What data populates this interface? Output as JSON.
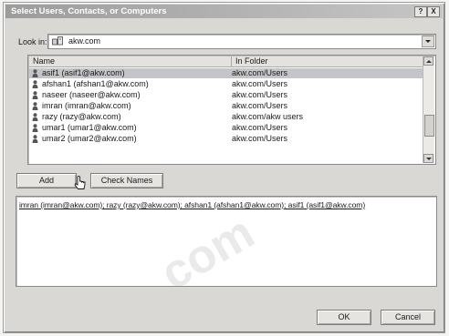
{
  "window": {
    "title": "Select Users, Contacts, or Computers",
    "help_label": "?",
    "close_label": "X"
  },
  "lookin": {
    "label": "Look in:",
    "value": "akw.com",
    "icon": "domain-icon"
  },
  "list": {
    "columns": [
      "Name",
      "In Folder"
    ],
    "rows": [
      {
        "name": "asif1 (asif1@akw.com)",
        "folder": "akw.com/Users",
        "selected": true
      },
      {
        "name": "afshan1 (afshan1@akw.com)",
        "folder": "akw.com/Users",
        "selected": false
      },
      {
        "name": "naseer (naseer@akw.com)",
        "folder": "akw.com/Users",
        "selected": false
      },
      {
        "name": "imran (imran@akw.com)",
        "folder": "akw.com/Users",
        "selected": false
      },
      {
        "name": "razy (razy@akw.com)",
        "folder": "akw.com/akw users",
        "selected": false
      },
      {
        "name": "umar1 (umar1@akw.com)",
        "folder": "akw.com/Users",
        "selected": false
      },
      {
        "name": "umar2 (umar2@akw.com)",
        "folder": "akw.com/Users",
        "selected": false
      }
    ],
    "row_icon": "user-icon"
  },
  "buttons": {
    "add": "Add",
    "check_names": "Check Names",
    "ok": "OK",
    "cancel": "Cancel"
  },
  "selected_entries": "imran (imran@akw.com); razy (razy@akw.com); afshan1 (afshan1@akw.com); asif1 (asif1@akw.com)",
  "watermark": "com",
  "colors": {
    "title_start": "#9c9c9c",
    "title_end": "#c6c6c6",
    "selection": "#c3c5c8",
    "dialog_face": "#d9d8d4"
  }
}
